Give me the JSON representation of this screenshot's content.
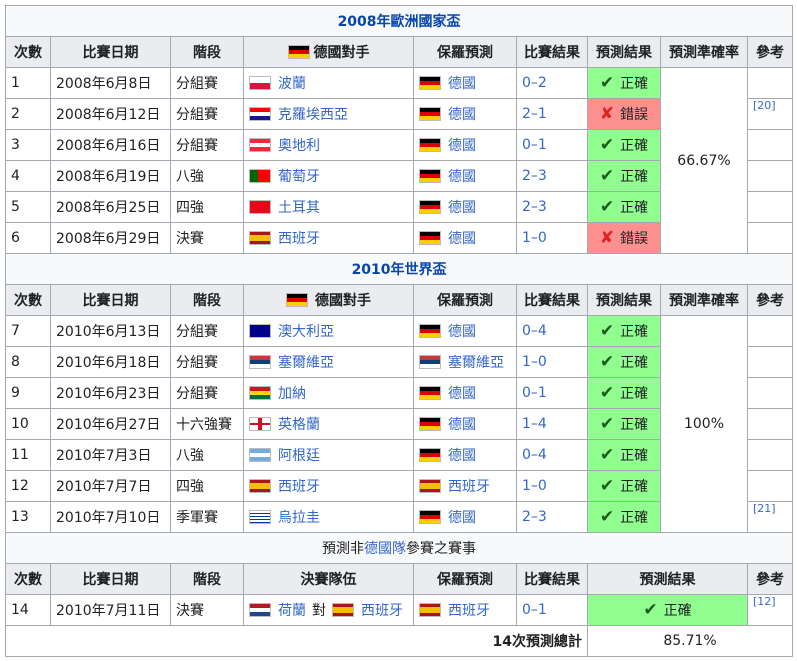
{
  "headers": {
    "no": "次數",
    "date": "比賽日期",
    "stage": "階段",
    "opponent": "德國對手",
    "prediction": "保羅預測",
    "result": "比賽結果",
    "outcome": "預測結果",
    "accuracy": "預測準確率",
    "ref": "參考",
    "finalists": "決賽隊伍"
  },
  "section1": {
    "title": "2008年歐洲國家盃",
    "accuracy": "66.67%",
    "ref": "[20]",
    "rows": [
      {
        "no": "1",
        "date": "2008年6月8日",
        "stage": "分組賽",
        "opp": "波蘭",
        "oppFlag": "pl",
        "pred": "德國",
        "predFlag": "de",
        "score": "0–2",
        "status": "正確",
        "ok": true
      },
      {
        "no": "2",
        "date": "2008年6月12日",
        "stage": "分組賽",
        "opp": "克羅埃西亞",
        "oppFlag": "hr",
        "pred": "德國",
        "predFlag": "de",
        "score": "2–1",
        "status": "錯誤",
        "ok": false
      },
      {
        "no": "3",
        "date": "2008年6月16日",
        "stage": "分組賽",
        "opp": "奧地利",
        "oppFlag": "at",
        "pred": "德國",
        "predFlag": "de",
        "score": "0–1",
        "status": "正確",
        "ok": true
      },
      {
        "no": "4",
        "date": "2008年6月19日",
        "stage": "八強",
        "opp": "葡萄牙",
        "oppFlag": "pt",
        "pred": "德國",
        "predFlag": "de",
        "score": "2–3",
        "status": "正確",
        "ok": true
      },
      {
        "no": "5",
        "date": "2008年6月25日",
        "stage": "四強",
        "opp": "土耳其",
        "oppFlag": "tr",
        "pred": "德國",
        "predFlag": "de",
        "score": "2–3",
        "status": "正確",
        "ok": true
      },
      {
        "no": "6",
        "date": "2008年6月29日",
        "stage": "決賽",
        "opp": "西班牙",
        "oppFlag": "es",
        "pred": "德國",
        "predFlag": "de",
        "score": "1–0",
        "status": "錯誤",
        "ok": false
      }
    ]
  },
  "section2": {
    "title": "2010年世界盃",
    "accuracy": "100%",
    "ref": "[21]",
    "rows": [
      {
        "no": "7",
        "date": "2010年6月13日",
        "stage": "分組賽",
        "opp": "澳大利亞",
        "oppFlag": "au",
        "pred": "德國",
        "predFlag": "de",
        "score": "0–4",
        "status": "正確",
        "ok": true
      },
      {
        "no": "8",
        "date": "2010年6月18日",
        "stage": "分組賽",
        "opp": "塞爾維亞",
        "oppFlag": "rs",
        "pred": "塞爾維亞",
        "predFlag": "rs",
        "score": "1–0",
        "status": "正確",
        "ok": true
      },
      {
        "no": "9",
        "date": "2010年6月23日",
        "stage": "分組賽",
        "opp": "加納",
        "oppFlag": "gh",
        "pred": "德國",
        "predFlag": "de",
        "score": "0–1",
        "status": "正確",
        "ok": true
      },
      {
        "no": "10",
        "date": "2010年6月27日",
        "stage": "十六強賽",
        "opp": "英格蘭",
        "oppFlag": "en",
        "pred": "德國",
        "predFlag": "de",
        "score": "1–4",
        "status": "正確",
        "ok": true
      },
      {
        "no": "11",
        "date": "2010年7月3日",
        "stage": "八強",
        "opp": "阿根廷",
        "oppFlag": "ar",
        "pred": "德國",
        "predFlag": "de",
        "score": "0–4",
        "status": "正確",
        "ok": true
      },
      {
        "no": "12",
        "date": "2010年7月7日",
        "stage": "四強",
        "opp": "西班牙",
        "oppFlag": "es",
        "pred": "西班牙",
        "predFlag": "es",
        "score": "1–0",
        "status": "正確",
        "ok": true
      },
      {
        "no": "13",
        "date": "2010年7月10日",
        "stage": "季軍賽",
        "opp": "烏拉圭",
        "oppFlag": "uy",
        "pred": "德國",
        "predFlag": "de",
        "score": "2–3",
        "status": "正確",
        "ok": true
      }
    ]
  },
  "section3": {
    "title_pre": "預測非",
    "title_link": "德國隊",
    "title_post": "參賽之賽事",
    "ref": "[12]",
    "row": {
      "no": "14",
      "date": "2010年7月11日",
      "stage": "決賽",
      "teamA": "荷蘭",
      "vs": "對",
      "teamB": "西班牙",
      "pred": "西班牙",
      "score": "0–1",
      "status": "正確"
    }
  },
  "total": {
    "label": "14次預測總計",
    "value": "85.71%"
  },
  "colors": {
    "correct": "#90ff90",
    "wrong": "#ff9090",
    "header": "#eaecf0",
    "link": "#3366cc"
  }
}
